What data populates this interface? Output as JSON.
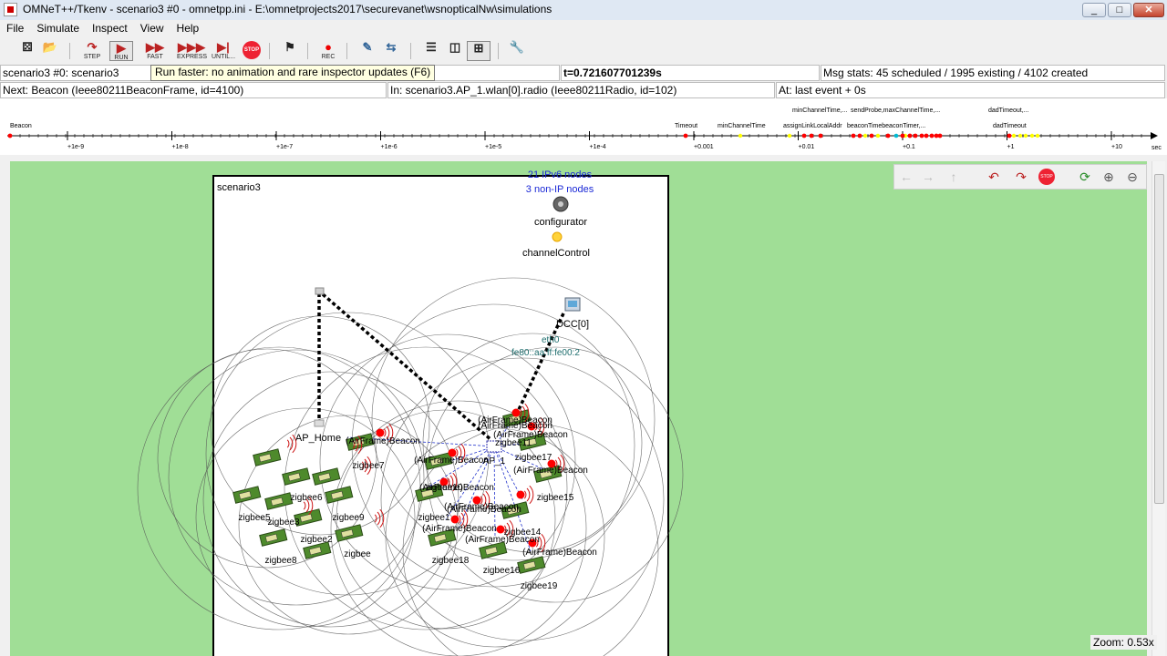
{
  "window": {
    "title": "OMNeT++/Tkenv - scenario3 #0 - omnetpp.ini - E:\\omnetprojects2017\\securevanet\\wsnopticalNw\\simulations",
    "minimize": "_",
    "maximize": "□",
    "close": "✕"
  },
  "menu": [
    "File",
    "Simulate",
    "Inspect",
    "View",
    "Help"
  ],
  "toolbar": {
    "buttons": [
      {
        "name": "new-network-icon",
        "glyph": "⚄",
        "label": ""
      },
      {
        "name": "open-inifile-icon",
        "glyph": "📂",
        "label": ""
      },
      {
        "name": "step-icon",
        "glyph": "↷",
        "label": "STEP"
      },
      {
        "name": "run-icon",
        "glyph": "▶",
        "label": "RUN"
      },
      {
        "name": "fast-icon",
        "glyph": "▶▶",
        "label": "FAST"
      },
      {
        "name": "express-icon",
        "glyph": "▶▶▶",
        "label": "EXPRESS"
      },
      {
        "name": "until-icon",
        "glyph": "▶|",
        "label": "UNTIL..."
      },
      {
        "name": "stop-icon",
        "glyph": "STOP",
        "label": ""
      },
      {
        "name": "finish-icon",
        "glyph": "⚑",
        "label": ""
      },
      {
        "name": "record-icon",
        "glyph": "●",
        "label": "REC"
      },
      {
        "name": "find-objects-icon",
        "glyph": "✎",
        "label": ""
      },
      {
        "name": "object-tree-icon",
        "glyph": "⇆",
        "label": ""
      },
      {
        "name": "layout-horizontal-icon",
        "glyph": "☰",
        "label": ""
      },
      {
        "name": "layout-vertical-icon",
        "glyph": "◫",
        "label": ""
      },
      {
        "name": "timeline-toggle-icon",
        "glyph": "⊞",
        "label": ""
      },
      {
        "name": "options-icon",
        "glyph": "🔧",
        "label": ""
      }
    ]
  },
  "tooltip": "Run faster: no animation and rare inspector updates (F6)",
  "status": {
    "network": "scenario3 #0: scenario3",
    "time": "t=0.721607701239s",
    "msgstats": "Msg stats: 45 scheduled / 1995 existing / 4102 created",
    "next": "Next: Beacon (Ieee80211BeaconFrame, id=4100)",
    "in": "In: scenario3.AP_1.wlan[0].radio (Ieee80211Radio, id=102)",
    "at": "At: last event + 0s"
  },
  "timeline": {
    "ticks": [
      "+1e-9",
      "+1e-8",
      "+1e-7",
      "+1e-6",
      "+1e-5",
      "+1e-4",
      "+0.001",
      "+0.01",
      "+0.1",
      "+1",
      "+10"
    ],
    "unit": "sec",
    "labels_row1": [
      "minChannelTime,...",
      "sendProbe,maxChannelTime,...",
      "dadTimeout,..."
    ],
    "labels_row2": [
      "Beacon",
      "Timeout",
      "minChannelTime",
      "assignLinkLocalAddr",
      "beaconTimebeaconTimer,...",
      "dadTimeout"
    ]
  },
  "network": {
    "name": "scenario3",
    "ipv6_nodes": "21 IPv6 nodes",
    "nonip_nodes": "3 non-IP nodes",
    "configurator": "configurator",
    "channelControl": "channelControl",
    "dcc": "DCC[0]",
    "eth": "eth0",
    "addr": "fe80::aa:ff:fe00:2",
    "ap_home": "AP_Home",
    "ap_1": "AP_1",
    "zigbee_labels": [
      "zigbee5",
      "zigbee6",
      "zigbee3",
      "zigbee8",
      "zigbee2",
      "zigbee9",
      "zigbee",
      "zigbee7",
      "zigbee10",
      "zigbee1",
      "zigbee18",
      "zigbee16",
      "zigbee19",
      "zigbee14",
      "zigbee15",
      "zigbee17",
      "zigbee11"
    ],
    "airframe_labels": [
      "(AirFrame)Beacon"
    ]
  },
  "nav": {
    "back": "←",
    "forward": "→",
    "up": "↑",
    "undo": "↶",
    "redo": "↷",
    "stop": "STOP",
    "refresh": "⟳",
    "zoom_in": "⊕",
    "zoom_out": "⊖"
  },
  "zoom": "Zoom: 0.53x",
  "colors": {
    "canvas": "#a0de96",
    "event": "#ff0000",
    "highlight": "#ffff00"
  }
}
